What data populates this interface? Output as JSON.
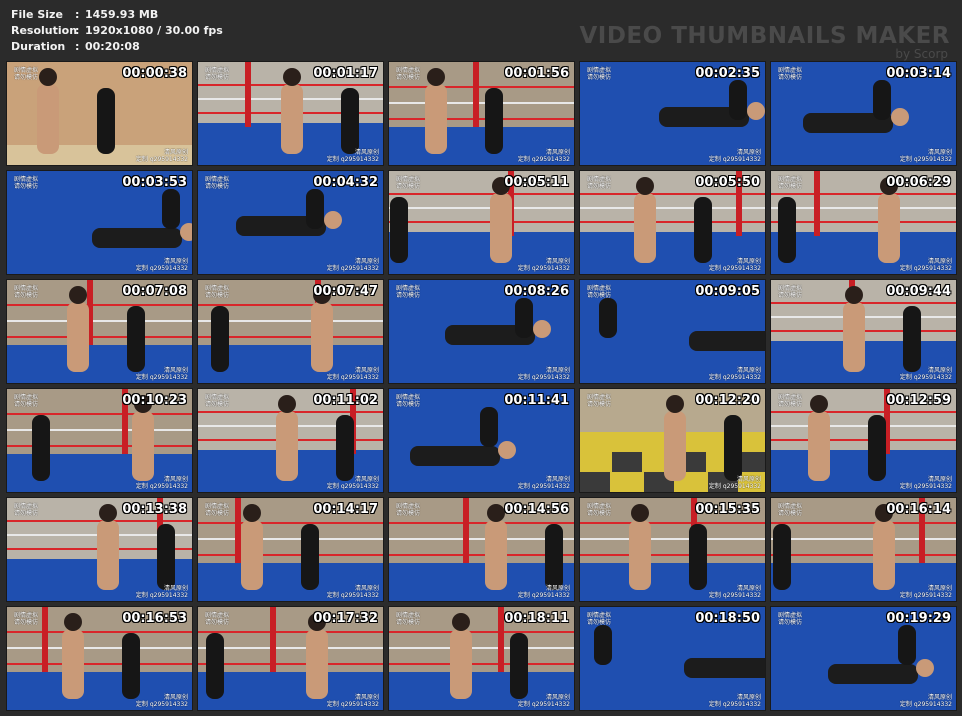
{
  "header": {
    "file_size_label": "File Size",
    "file_size_value": "1459.93 MB",
    "resolution_label": "Resolution",
    "resolution_value": "1920x1080 / 30.00 fps",
    "duration_label": "Duration",
    "duration_value": "00:20:08",
    "colon": ":",
    "brand_title": "VIDEO THUMBNAILS MAKER",
    "brand_sub": "by Scorp"
  },
  "watermark": {
    "top_left_line1": "剧情虚拟",
    "top_left_line2": "请勿模仿",
    "bottom_right_line1": "清风原创",
    "bottom_right_line2": "定制 q295914332"
  },
  "thumbnails": [
    {
      "time": "00:00:38",
      "scene": "closeup"
    },
    {
      "time": "00:01:17",
      "scene": "gym"
    },
    {
      "time": "00:01:56",
      "scene": "ring"
    },
    {
      "time": "00:02:35",
      "scene": "floor"
    },
    {
      "time": "00:03:14",
      "scene": "floor"
    },
    {
      "time": "00:03:53",
      "scene": "floor"
    },
    {
      "time": "00:04:32",
      "scene": "floor"
    },
    {
      "time": "00:05:11",
      "scene": "gym"
    },
    {
      "time": "00:05:50",
      "scene": "gym"
    },
    {
      "time": "00:06:29",
      "scene": "gym"
    },
    {
      "time": "00:07:08",
      "scene": "ring"
    },
    {
      "time": "00:07:47",
      "scene": "ring"
    },
    {
      "time": "00:08:26",
      "scene": "floor"
    },
    {
      "time": "00:09:05",
      "scene": "floor"
    },
    {
      "time": "00:09:44",
      "scene": "gym"
    },
    {
      "time": "00:10:23",
      "scene": "ring"
    },
    {
      "time": "00:11:02",
      "scene": "gym"
    },
    {
      "time": "00:11:41",
      "scene": "floor"
    },
    {
      "time": "00:12:20",
      "scene": "mat"
    },
    {
      "time": "00:12:59",
      "scene": "gym"
    },
    {
      "time": "00:13:38",
      "scene": "gym"
    },
    {
      "time": "00:14:17",
      "scene": "ring"
    },
    {
      "time": "00:14:56",
      "scene": "ring"
    },
    {
      "time": "00:15:35",
      "scene": "ring"
    },
    {
      "time": "00:16:14",
      "scene": "ring"
    },
    {
      "time": "00:16:53",
      "scene": "ring"
    },
    {
      "time": "00:17:32",
      "scene": "ring"
    },
    {
      "time": "00:18:11",
      "scene": "ring"
    },
    {
      "time": "00:18:50",
      "scene": "floor"
    },
    {
      "time": "00:19:29",
      "scene": "floor"
    }
  ],
  "colors": {
    "background": "#2b2b2b",
    "header_text": "#f2f2f2",
    "brand_text": "#4a4a4a",
    "mat_blue": "#1f4fb0",
    "rope_red": "#d8262a",
    "mat_yellow": "#d9c23a"
  }
}
